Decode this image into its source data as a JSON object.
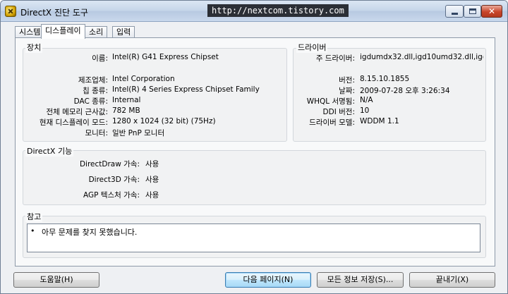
{
  "window": {
    "title": "DirectX 진단 도구",
    "watermark": "http://nextcom.tistory.com"
  },
  "tabs": [
    {
      "label": "시스템"
    },
    {
      "label": "디스플레이"
    },
    {
      "label": "소리"
    },
    {
      "label": "입력"
    }
  ],
  "device": {
    "header": "장치",
    "rows": [
      {
        "label": "이름:",
        "value": "Intel(R) G41 Express Chipset"
      },
      {
        "label": "제조업체:",
        "value": "Intel Corporation"
      },
      {
        "label": "칩 종류:",
        "value": "Intel(R) 4 Series Express Chipset Family"
      },
      {
        "label": "DAC 종류:",
        "value": "Internal"
      },
      {
        "label": "전체 메모리 근사값:",
        "value": "782 MB"
      },
      {
        "label": "현재 디스플레이 모드:",
        "value": "1280 x 1024 (32 bit) (75Hz)"
      },
      {
        "label": "모니터:",
        "value": "일반 PnP 모니터"
      }
    ]
  },
  "driver": {
    "header": "드라이버",
    "rows": [
      {
        "label": "주 드라이버:",
        "value": "igdumdx32.dll,igd10umd32.dll,igd10u"
      },
      {
        "label": "버전:",
        "value": "8.15.10.1855"
      },
      {
        "label": "날짜:",
        "value": "2009-07-28 오후 3:26:34"
      },
      {
        "label": "WHQL 서명됨:",
        "value": "N/A"
      },
      {
        "label": "DDI 버전:",
        "value": "10"
      },
      {
        "label": "드라이버 모델:",
        "value": "WDDM 1.1"
      }
    ]
  },
  "directx": {
    "header": "DirectX 기능",
    "rows": [
      {
        "label": "DirectDraw 가속:",
        "value": "사용"
      },
      {
        "label": "Direct3D 가속:",
        "value": "사용"
      },
      {
        "label": "AGP 텍스처 가속:",
        "value": "사용"
      }
    ]
  },
  "notes": {
    "header": "참고",
    "bullet": "•",
    "text": "아무 문제를 찾지 못했습니다."
  },
  "buttons": {
    "help": "도움말(H)",
    "next": "다음 페이지(N)",
    "save": "모든 정보 저장(S)...",
    "exit": "끝내기(X)"
  }
}
